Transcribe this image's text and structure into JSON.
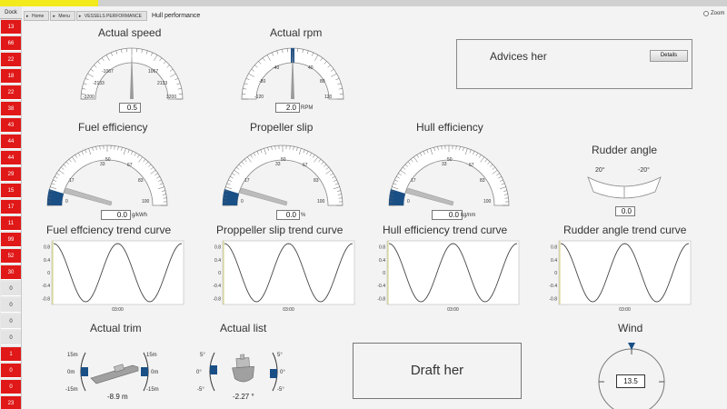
{
  "sidebar": {
    "dock_label": "Dock",
    "cells": [
      {
        "label": "13",
        "state": "red"
      },
      {
        "label": "66",
        "state": "red"
      },
      {
        "label": "22",
        "state": "red"
      },
      {
        "label": "18",
        "state": "red"
      },
      {
        "label": "22",
        "state": "red"
      },
      {
        "label": "38",
        "state": "red"
      },
      {
        "label": "43",
        "state": "red"
      },
      {
        "label": "44",
        "state": "red"
      },
      {
        "label": "44",
        "state": "red"
      },
      {
        "label": "29",
        "state": "red"
      },
      {
        "label": "15",
        "state": "red"
      },
      {
        "label": "17",
        "state": "red"
      },
      {
        "label": "11",
        "state": "red"
      },
      {
        "label": "99",
        "state": "red"
      },
      {
        "label": "52",
        "state": "red"
      },
      {
        "label": "30",
        "state": "red"
      },
      {
        "label": "0",
        "state": "gray"
      },
      {
        "label": "0",
        "state": "gray"
      },
      {
        "label": "0",
        "state": "gray"
      },
      {
        "label": "0",
        "state": "gray"
      },
      {
        "label": "1",
        "state": "red"
      },
      {
        "label": "0",
        "state": "red"
      },
      {
        "label": "0",
        "state": "red"
      },
      {
        "label": "23",
        "state": "red"
      }
    ]
  },
  "breadcrumb": [
    "Home",
    "Menu",
    "VESSELS PERFORMANCE"
  ],
  "page_title": "Hull performance",
  "zoom_label": "Zoom",
  "colors": {
    "sidebar_red": "#e01818",
    "gauge_band": "#1a4f86"
  },
  "speed": {
    "title": "Actual speed",
    "ticks": [
      "-1067",
      "1067",
      "-2133",
      "2133",
      "-3200",
      "3200"
    ],
    "value": "0.5"
  },
  "rpm": {
    "title": "Actual rpm",
    "ticks": [
      "-40",
      "40",
      "-80",
      "80",
      "-120",
      "120"
    ],
    "value": "2.0",
    "unit": "RPM"
  },
  "advice": {
    "title": "Advices her",
    "button": "Details"
  },
  "fuel": {
    "title": "Fuel efficiency",
    "ticks": [
      "33",
      "50",
      "67",
      "17",
      "83",
      "0",
      "100"
    ],
    "value": "0.0",
    "unit": "g/kWh"
  },
  "slip": {
    "title": "Propeller slip",
    "ticks": [
      "33",
      "50",
      "67",
      "17",
      "83",
      "0",
      "100"
    ],
    "value": "0.0",
    "unit": "%"
  },
  "hull": {
    "title": "Hull efficiency",
    "ticks": [
      "33",
      "50",
      "67",
      "17",
      "83",
      "0",
      "100"
    ],
    "value": "0.0",
    "unit": "kg/nm"
  },
  "rudder": {
    "title": "Rudder angle",
    "left_label": "20°",
    "right_label": "-20°",
    "value": "0.0"
  },
  "trends": [
    {
      "title": "Fuel effciency trend curve",
      "x_label": "03:00",
      "y_ticks": [
        "0.8",
        "0.4",
        "0",
        "-0.4",
        "-0.8"
      ]
    },
    {
      "title": "Proppeller slip trend curve",
      "x_label": "03:00",
      "y_ticks": [
        "0.8",
        "0.4",
        "0",
        "-0.4",
        "-0.8"
      ]
    },
    {
      "title": "Hull efficiency trend curve",
      "x_label": "03:00",
      "y_ticks": [
        "0.8",
        "0.4",
        "0",
        "-0.4",
        "-0.8"
      ]
    },
    {
      "title": "Rudder angle trend curve",
      "x_label": "03:00",
      "y_ticks": [
        "0.8",
        "0.4",
        "0",
        "-0.4",
        "-0.8"
      ]
    }
  ],
  "trim": {
    "title": "Actual trim",
    "labels": [
      "15m",
      "0m",
      "-15m",
      "15m",
      "0m",
      "-15m"
    ],
    "value": "-8.9 m"
  },
  "list": {
    "title": "Actual list",
    "labels": [
      "5°",
      "0°",
      "-5°",
      "5°",
      "0°",
      "-5°"
    ],
    "value": "-2.27 °"
  },
  "draft": {
    "title": "Draft her"
  },
  "wind": {
    "title": "Wind",
    "value": "13.5"
  }
}
